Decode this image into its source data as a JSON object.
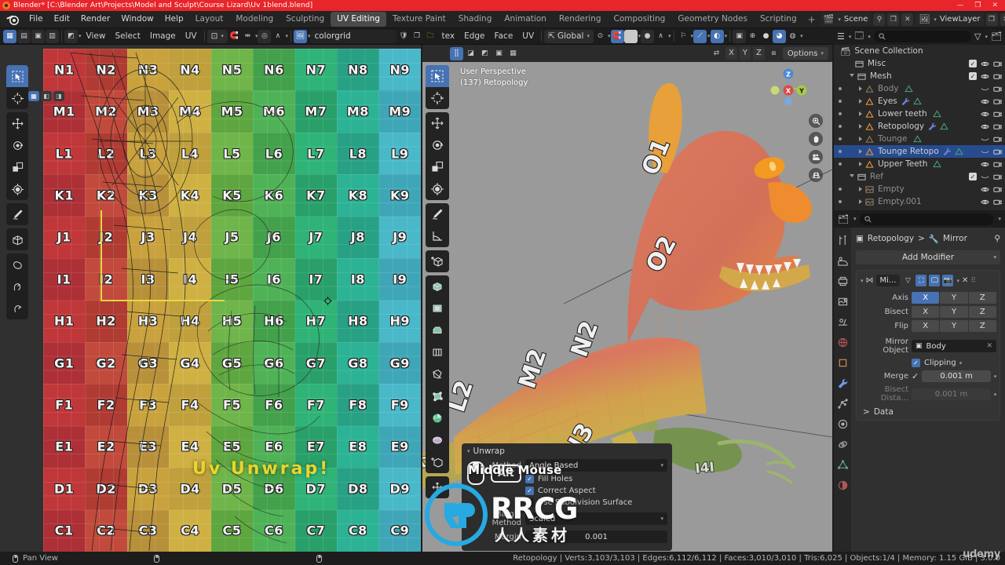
{
  "titlebar": {
    "text": "Blender* [C:\\Blender Art\\Projects\\Model and Sculpt\\Course Lizard\\Uv 1blend.blend]",
    "minimize": "—",
    "maximize": "❐",
    "close": "✕",
    "accent_color": "#e8252a"
  },
  "topbar": {
    "menus": [
      "File",
      "Edit",
      "Render",
      "Window",
      "Help"
    ],
    "workspaces": [
      {
        "label": "Layout",
        "active": false
      },
      {
        "label": "Modeling",
        "active": false
      },
      {
        "label": "Sculpting",
        "active": false
      },
      {
        "label": "UV Editing",
        "active": true
      },
      {
        "label": "Texture Paint",
        "active": false
      },
      {
        "label": "Shading",
        "active": false
      },
      {
        "label": "Animation",
        "active": false
      },
      {
        "label": "Rendering",
        "active": false
      },
      {
        "label": "Compositing",
        "active": false
      },
      {
        "label": "Geometry Nodes",
        "active": false
      },
      {
        "label": "Scripting",
        "active": false
      }
    ],
    "add_workspace": "+",
    "scene_name": "Scene",
    "viewlayer_name": "ViewLayer"
  },
  "editor_header": {
    "uv_menus": [
      "View",
      "Select",
      "Image",
      "UV"
    ],
    "image_name": "colorgrid",
    "mesh_select_modes": [
      "tex",
      "Edge",
      "Face",
      "UV"
    ],
    "transform_orientation": "Global"
  },
  "uv_editor": {
    "row_labels": [
      "N",
      "M",
      "L",
      "K",
      "J",
      "I",
      "H",
      "G",
      "F",
      "E",
      "D",
      "C"
    ],
    "col_labels": [
      "1",
      "2",
      "3",
      "4",
      "5",
      "6",
      "7",
      "8",
      "9"
    ],
    "overlay_text": "Uv Unwrap!",
    "overlay_color": "#ead52c",
    "selection_color": "#e8d840"
  },
  "viewport": {
    "view_name": "User Perspective",
    "object_info": "(137) Retopology",
    "options_label": "Options",
    "axis_locks": [
      "X",
      "Y",
      "Z"
    ],
    "gizmo_axes": {
      "x": "X",
      "y": "Y",
      "z": "Z"
    },
    "background_color": "#9a9a9a"
  },
  "operator_panel": {
    "title": "Unwrap",
    "method_label": "Method",
    "method_value": "Angle Based",
    "fill_holes_label": "Fill Holes",
    "fill_holes_checked": true,
    "correct_aspect_label": "Correct Aspect",
    "correct_aspect_checked": true,
    "subdivision_label": "Use Subdivision Surface",
    "subdivision_checked": false,
    "margin_method_label": "Margin Method",
    "margin_method_value": "Scaled",
    "margin_label": "Margin",
    "margin_value": "0.001"
  },
  "key_overlay": {
    "text": "Middle Mouse",
    "modifier": "Alt"
  },
  "watermark": {
    "logo_text": "RRCG",
    "cn_text": "人人素材",
    "corner": "udemy"
  },
  "outliner": {
    "root": "Scene Collection",
    "rows": [
      {
        "label": "Misc",
        "indent": 1,
        "kind": "collection",
        "dim": false,
        "selected": false,
        "checkbox": true,
        "eye": "open",
        "camera": true,
        "expand": null
      },
      {
        "label": "Mesh",
        "indent": 1,
        "kind": "collection",
        "dim": false,
        "selected": false,
        "checkbox": true,
        "eye": "open",
        "camera": true,
        "expand": "down"
      },
      {
        "label": "Body",
        "indent": 2,
        "kind": "mesh",
        "dim": true,
        "selected": false,
        "checkbox": false,
        "eye": "closed",
        "camera": true,
        "expand": "right"
      },
      {
        "label": "Eyes",
        "indent": 2,
        "kind": "mesh",
        "dim": false,
        "selected": false,
        "checkbox": false,
        "eye": "open",
        "camera": true,
        "expand": "right"
      },
      {
        "label": "Lower teeth",
        "indent": 2,
        "kind": "mesh",
        "dim": false,
        "selected": false,
        "checkbox": false,
        "eye": "open",
        "camera": true,
        "expand": "right"
      },
      {
        "label": "Retopology",
        "indent": 2,
        "kind": "mesh",
        "dim": false,
        "selected": false,
        "checkbox": false,
        "eye": "open",
        "camera": true,
        "expand": "right"
      },
      {
        "label": "Tounge",
        "indent": 2,
        "kind": "mesh",
        "dim": true,
        "selected": false,
        "checkbox": false,
        "eye": "closed",
        "camera": true,
        "expand": "right"
      },
      {
        "label": "Tounge Retopo",
        "indent": 2,
        "kind": "mesh",
        "dim": false,
        "selected": true,
        "checkbox": false,
        "eye": "closed",
        "camera": true,
        "expand": "right"
      },
      {
        "label": "Upper Teeth",
        "indent": 2,
        "kind": "mesh",
        "dim": false,
        "selected": false,
        "checkbox": false,
        "eye": "open",
        "camera": true,
        "expand": "right"
      },
      {
        "label": "Ref",
        "indent": 1,
        "kind": "collection",
        "dim": true,
        "selected": false,
        "checkbox": true,
        "eye": "closed",
        "camera": true,
        "expand": "down"
      },
      {
        "label": "Empty",
        "indent": 2,
        "kind": "empty",
        "dim": true,
        "selected": false,
        "checkbox": false,
        "eye": "open",
        "camera": true,
        "expand": "right"
      },
      {
        "label": "Empty.001",
        "indent": 2,
        "kind": "empty",
        "dim": true,
        "selected": false,
        "checkbox": false,
        "eye": "open",
        "camera": true,
        "expand": "right"
      }
    ]
  },
  "properties": {
    "breadcrumb_object": "Retopology",
    "breadcrumb_modifier": "Mirror",
    "add_modifier": "Add Modifier",
    "modifier": {
      "name": "Mi...",
      "axis_label": "Axis",
      "axis_values": [
        "X",
        "Y",
        "Z"
      ],
      "axis_active": "X",
      "bisect_label": "Bisect",
      "bisect_values": [
        "X",
        "Y",
        "Z"
      ],
      "flip_label": "Flip",
      "flip_values": [
        "X",
        "Y",
        "Z"
      ],
      "mirror_object_label": "Mirror Object",
      "mirror_object_value": "Body",
      "clipping_label": "Clipping",
      "clipping_checked": true,
      "merge_label": "Merge",
      "merge_checked": true,
      "merge_value": "0.001 m",
      "bisect_distance_label": "Bisect Dista...",
      "bisect_distance_value": "0.001 m",
      "data_label": "Data"
    }
  },
  "statusbar": {
    "pan_view": "Pan View",
    "stats": "Retopology | Verts:3,103/3,103 | Edges:6,112/6,112 | Faces:3,010/3,010 | Tris:6,025 | Objects:1/4 | Memory: 1.15 GiB | 3.0.0"
  }
}
